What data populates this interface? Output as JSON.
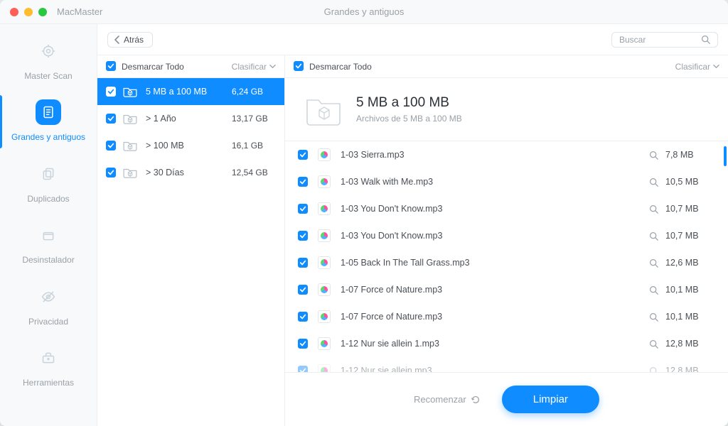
{
  "app": {
    "name": "MacMaster",
    "window_title": "Grandes y antiguos"
  },
  "toolbar": {
    "back": "Atrás",
    "search_placeholder": "Buscar"
  },
  "sidebar": {
    "items": [
      {
        "id": "master-scan",
        "label": "Master Scan",
        "icon": "target-icon"
      },
      {
        "id": "large-old",
        "label": "Grandes y antiguos",
        "icon": "document-icon",
        "active": true
      },
      {
        "id": "duplicates",
        "label": "Duplicados",
        "icon": "copies-icon"
      },
      {
        "id": "uninstaller",
        "label": "Desinstalador",
        "icon": "box-icon"
      },
      {
        "id": "privacy",
        "label": "Privacidad",
        "icon": "eye-off-icon"
      },
      {
        "id": "tools",
        "label": "Herramientas",
        "icon": "toolbox-icon"
      }
    ]
  },
  "left_pane": {
    "deselect_all": "Desmarcar Todo",
    "sort": "Clasificar",
    "categories": [
      {
        "label": "5 MB a 100 MB",
        "size": "6,24 GB",
        "selected": true
      },
      {
        "label": "> 1 Año",
        "size": "13,17 GB"
      },
      {
        "label": "> 100 MB",
        "size": "16,1 GB"
      },
      {
        "label": "> 30 Días",
        "size": "12,54 GB"
      }
    ]
  },
  "right_pane": {
    "deselect_all": "Desmarcar Todo",
    "sort": "Clasificar",
    "hero_title": "5 MB a 100 MB",
    "hero_sub": "Archivos de 5 MB a 100 MB",
    "files": [
      {
        "name": "1-03 Sierra.mp3",
        "size": "7,8 MB"
      },
      {
        "name": "1-03 Walk with Me.mp3",
        "size": "10,5 MB"
      },
      {
        "name": "1-03 You Don't Know.mp3",
        "size": "10,7 MB"
      },
      {
        "name": "1-03 You Don't Know.mp3",
        "size": "10,7 MB"
      },
      {
        "name": "1-05 Back In The Tall Grass.mp3",
        "size": "12,6 MB"
      },
      {
        "name": "1-07 Force of Nature.mp3",
        "size": "10,1 MB"
      },
      {
        "name": "1-07 Force of Nature.mp3",
        "size": "10,1 MB"
      },
      {
        "name": "1-12 Nur sie allein 1.mp3",
        "size": "12,8 MB"
      },
      {
        "name": "1-12 Nur sie allein.mp3",
        "size": "12,8 MB",
        "faded": true
      }
    ]
  },
  "footer": {
    "restart": "Recomenzar",
    "clean": "Limpiar"
  }
}
